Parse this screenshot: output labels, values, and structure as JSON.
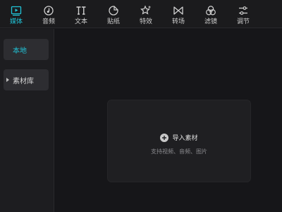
{
  "toolbar": {
    "tabs": [
      {
        "label": "媒体",
        "icon": "media-icon",
        "active": true
      },
      {
        "label": "音频",
        "icon": "audio-icon",
        "active": false
      },
      {
        "label": "文本",
        "icon": "text-icon",
        "active": false
      },
      {
        "label": "贴纸",
        "icon": "sticker-icon",
        "active": false
      },
      {
        "label": "特效",
        "icon": "effects-icon",
        "active": false
      },
      {
        "label": "转场",
        "icon": "transition-icon",
        "active": false
      },
      {
        "label": "滤镜",
        "icon": "filter-icon",
        "active": false
      },
      {
        "label": "调节",
        "icon": "adjust-icon",
        "active": false
      }
    ]
  },
  "sidebar": {
    "local_label": "本地",
    "library_label": "素材库"
  },
  "import": {
    "button_label": "导入素材",
    "hint": "支持视频、音频、图片"
  },
  "colors": {
    "accent": "#21c4d8",
    "background": "#151518",
    "panel": "#1f1f22"
  }
}
